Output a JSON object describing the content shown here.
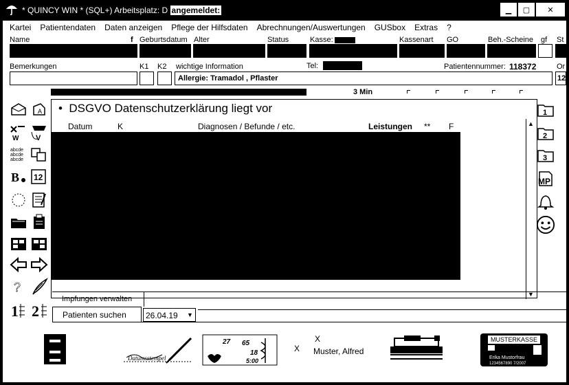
{
  "window": {
    "title": "* QUINCY WIN * (SQL+) Arbeitsplatz: D",
    "logged_in_label": "angemeldet:",
    "minimize": "▁",
    "maximize": "▢",
    "close": "✕"
  },
  "menu": [
    "Kartei",
    "Patientendaten",
    "Daten anzeigen",
    "Pflege der Hilfsdaten",
    "Abrechnungen/Auswertungen",
    "GUSbox",
    "Extras",
    "?"
  ],
  "header_fields": {
    "name": "Name",
    "f": "f",
    "geburtsdatum": "Geburtsdatum",
    "alter": "Alter",
    "status": "Status",
    "kasse": "Kasse:",
    "kassenart": "Kassenart",
    "go": "GO",
    "beh_scheine": "Beh.-Scheine",
    "gf": "gf",
    "st": "St",
    "bemerkungen": "Bemerkungen",
    "k1": "K1",
    "k2": "K2",
    "wichtige_information": "wichtige Information",
    "tel": "Tel:",
    "patientennummer_label": "Patientennummer:",
    "patientennummer_value": "118372",
    "or": "Or",
    "allergie": "Allergie: Tramadol ,  Pflaster",
    "right_trunc": "12"
  },
  "timer": "3 Min",
  "main": {
    "notice": "DSGVO Datenschutzerklärung liegt vor",
    "columns": {
      "datum": "Datum",
      "k": "K",
      "diagnosen": "Diagnosen / Befunde / etc.",
      "leistungen": "Leistungen",
      "stars": "**",
      "f": "F"
    }
  },
  "right_tabs": [
    "1",
    "2",
    "3",
    "MP"
  ],
  "bottom": {
    "impfungen": "Impfungen verwalten",
    "patienten_suchen": "Patienten suchen",
    "date": "26.04.19",
    "x1": "X",
    "x2": "X",
    "patient_name": "Muster, Alfred",
    "card": {
      "title": "MUSTERKASSE",
      "holder": "Erika Mustorfrau",
      "number": "1234567890  7/2007"
    },
    "lab_values": [
      "27",
      "65",
      "18",
      "5:00"
    ],
    "signature": "Datumsstempel"
  }
}
